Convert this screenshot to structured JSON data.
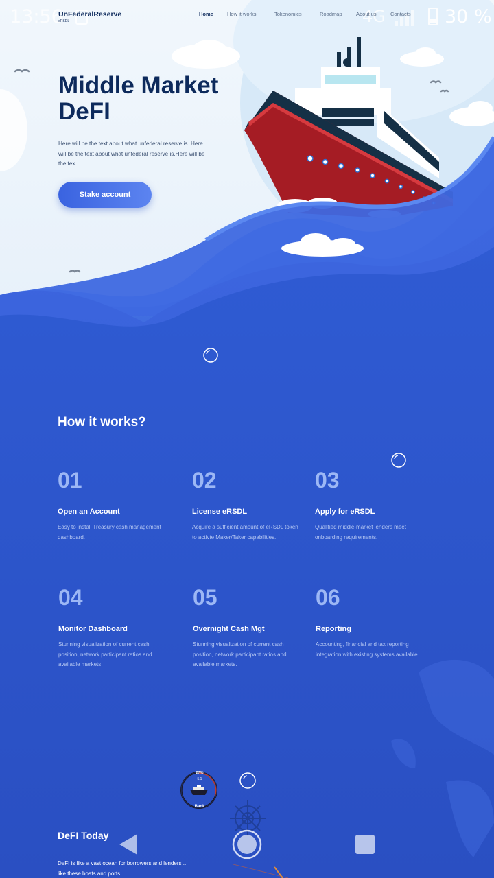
{
  "status_bar": {
    "time": "13:56",
    "network": "4G",
    "battery": "30 %"
  },
  "navbar": {
    "logo": "UnFederalReserve",
    "logo_sub": "eRSDL",
    "links": [
      "Home",
      "How it works",
      "Tokenomics",
      "Roadmap",
      "About us",
      "Contacts"
    ],
    "active": "Home"
  },
  "hero": {
    "title": "Middle Market DeFI",
    "text": "Here will be the text about what unfederal reserve is. Here will be the text about what unfederal reserve is.Here will be the tex",
    "cta": "Stake account"
  },
  "how_it_works": {
    "title": "How it works?",
    "steps": [
      {
        "num": "01",
        "title": "Open an Account",
        "desc": "Easy to install Treasury cash management dashboard."
      },
      {
        "num": "02",
        "title": "License eRSDL",
        "desc": "Acquire a sufficient amount of eRSDL token to activte Maker/Taker capabilities."
      },
      {
        "num": "03",
        "title": "Apply for eRSDL",
        "desc": "Qualified middle-market lenders meet onboarding requirements."
      },
      {
        "num": "04",
        "title": "Monitor Dashboard",
        "desc": "Stunning visualization of current cash position, network participant ratios and available markets."
      },
      {
        "num": "05",
        "title": "Overnight Cash Mgt",
        "desc": "Stunning visualization of current cash position, network participant ratios and available markets."
      },
      {
        "num": "06",
        "title": "Reporting",
        "desc": "Accounting, financial and tax reporting integration with existing systems available."
      }
    ]
  },
  "bank_widget": {
    "percent": "27%",
    "value": "5.1",
    "label": "Bank"
  },
  "defi_today": {
    "title": "DeFI Today",
    "text": "DeFI is like a vast ocean for borrowers and lenders .. like these boats and ports .."
  },
  "icons": [
    "sim-icon",
    "signal-icon",
    "battery-icon",
    "bird-icon",
    "cloud-icon",
    "ship-icon",
    "bubble-icon",
    "ship-wheel-icon",
    "back-icon",
    "home-icon",
    "recents-icon"
  ],
  "colors": {
    "brand_navy": "#0d2a5c",
    "ocean_blue": "#2d55c9",
    "cta_blue": "#3a63e0",
    "step_number": "#9cb7f5",
    "ship_red": "#a51c24"
  }
}
